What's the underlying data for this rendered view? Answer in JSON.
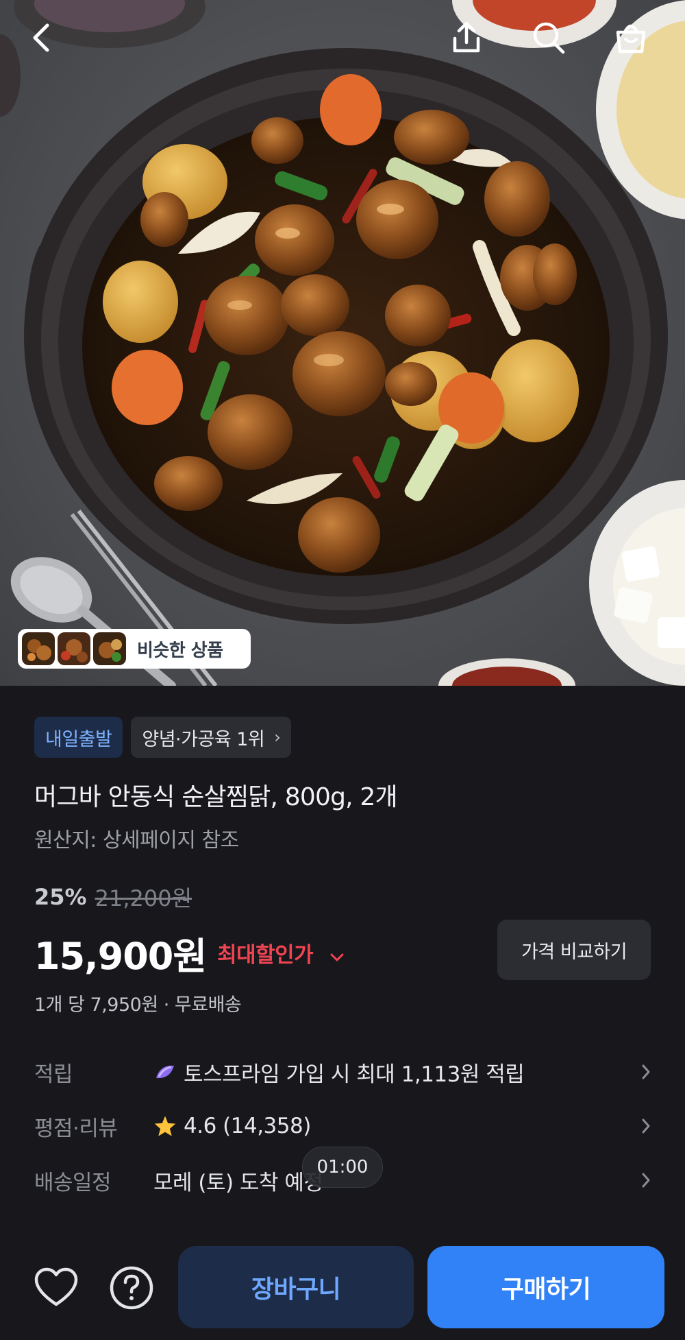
{
  "hero": {
    "image_label": "",
    "similar_products_label": "비슷한 상품"
  },
  "top_bar": {
    "back_icon": "chevron-left-icon",
    "share_icon": "share-icon",
    "search_icon": "search-icon",
    "cart_icon": "shopping-bag-icon"
  },
  "badges": {
    "delivery": "내일출발",
    "ranking": "양념·가공육 1위",
    "ranking_chevron": "›"
  },
  "product": {
    "title": "머그바 안동식 순살찜닭, 800g, 2개",
    "origin": "원산지: 상세페이지 참조"
  },
  "pricing": {
    "discount_percent": "25%",
    "original_price": "21,200원",
    "price": "15,900원",
    "max_discount_label": "최대할인가",
    "max_discount_arrow": "⌄",
    "compare_button": "가격 비교하기",
    "unit_info": "1개 당 7,950원 · 무료배송"
  },
  "info_rows": [
    {
      "label": "적립",
      "value": "토스프라임 가입 시 최대 1,113원 적립",
      "icon": "toss-prime-icon"
    },
    {
      "label": "평점·리뷰",
      "value": "4.6 (14,358)",
      "icon": "star-icon"
    },
    {
      "label": "배송일정",
      "value": "모레 (토) 도착 예정",
      "icon": ""
    }
  ],
  "timer": "01:00",
  "bottom_bar": {
    "cart_button": "장바구니",
    "buy_button": "구매하기"
  },
  "colors": {
    "background": "#17171c",
    "accent_blue": "#3182f6",
    "discount_red": "#f04452",
    "star_yellow": "#ffc33d"
  }
}
